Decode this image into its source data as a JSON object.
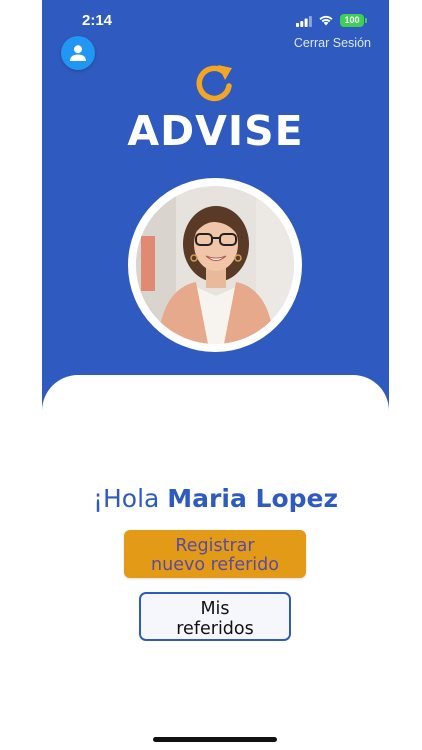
{
  "status_bar": {
    "time": "2:14",
    "battery": "100"
  },
  "header": {
    "logout_label": "Cerrar Sesión",
    "profile_icon": "user-icon"
  },
  "brand": {
    "name": "ADVISE",
    "logo_icon": "refresh-arrow-icon"
  },
  "colors": {
    "primary_blue": "#2f5bc0",
    "accent_orange": "#e39a17",
    "battery_green": "#3fcf55",
    "avatar_blue": "#2196f3"
  },
  "greeting": {
    "prefix": "¡Hola ",
    "name": "Maria Lopez"
  },
  "actions": {
    "register_line1": "Registrar",
    "register_line2": "nuevo referido",
    "my_referrals_line1": "Mis",
    "my_referrals_line2": "referidos"
  }
}
